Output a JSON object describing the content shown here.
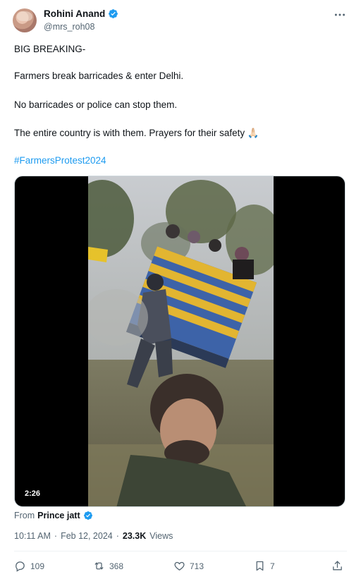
{
  "author": {
    "name": "Rohini Anand",
    "handle": "@mrs_roh08"
  },
  "tweet": {
    "lines": [
      "BIG BREAKING-",
      "Farmers break barricades & enter Delhi.",
      "No barricades or police can stop them.",
      "The entire country is with them. Prayers for their safety 🙏🏻"
    ],
    "hashtag": "#FarmersProtest2024"
  },
  "video": {
    "duration": "2:26"
  },
  "attribution": {
    "prefix": "From",
    "name": "Prince jatt"
  },
  "meta": {
    "time": "10:11 AM",
    "separator": "·",
    "date": "Feb 12, 2024",
    "views_count": "23.3K",
    "views_label": "Views"
  },
  "actions": {
    "replies": "109",
    "reposts": "368",
    "likes": "713",
    "bookmarks": "7"
  },
  "colors": {
    "accent": "#1d9bf0",
    "secondary_text": "#536471",
    "primary_text": "#0f1419"
  },
  "icons": [
    "verified-badge-icon",
    "more-options-icon",
    "reply-icon",
    "repost-icon",
    "like-icon",
    "bookmark-icon",
    "share-icon"
  ]
}
